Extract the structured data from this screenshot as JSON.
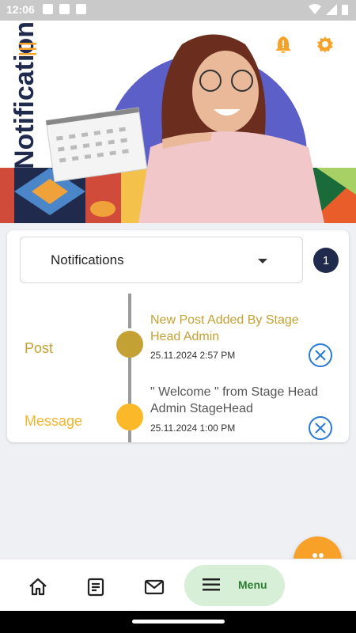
{
  "status_bar": {
    "time": "12:06"
  },
  "header": {
    "title": "Notifications",
    "icons": [
      "menu-icon",
      "bell-alert-icon",
      "settings-gear-icon"
    ]
  },
  "filter": {
    "selected": "Notifications",
    "count": "1"
  },
  "timeline": [
    {
      "type": "Post",
      "type_color": "#c4a134",
      "dot_color": "#c4a134",
      "title": "New Post Added By Stage Head Admin",
      "title_color": "#c4a134",
      "date": "25.11.2024 2:57 PM"
    },
    {
      "type": "Message",
      "type_color": "#f5b52b",
      "dot_color": "#fbb92a",
      "title": " \" Welcome  \" from Stage Head Admin  StageHead",
      "title_color": "#555555",
      "date": "25.11.2024 1:00 PM"
    }
  ],
  "bottom_nav": {
    "items": [
      "home-icon",
      "article-icon",
      "mail-icon"
    ],
    "menu_label": "Menu"
  },
  "colors": {
    "navy": "#1f2a4d",
    "accent_orange": "#f7a128",
    "close_blue": "#2979d6",
    "menu_green": "#2e7d32"
  }
}
